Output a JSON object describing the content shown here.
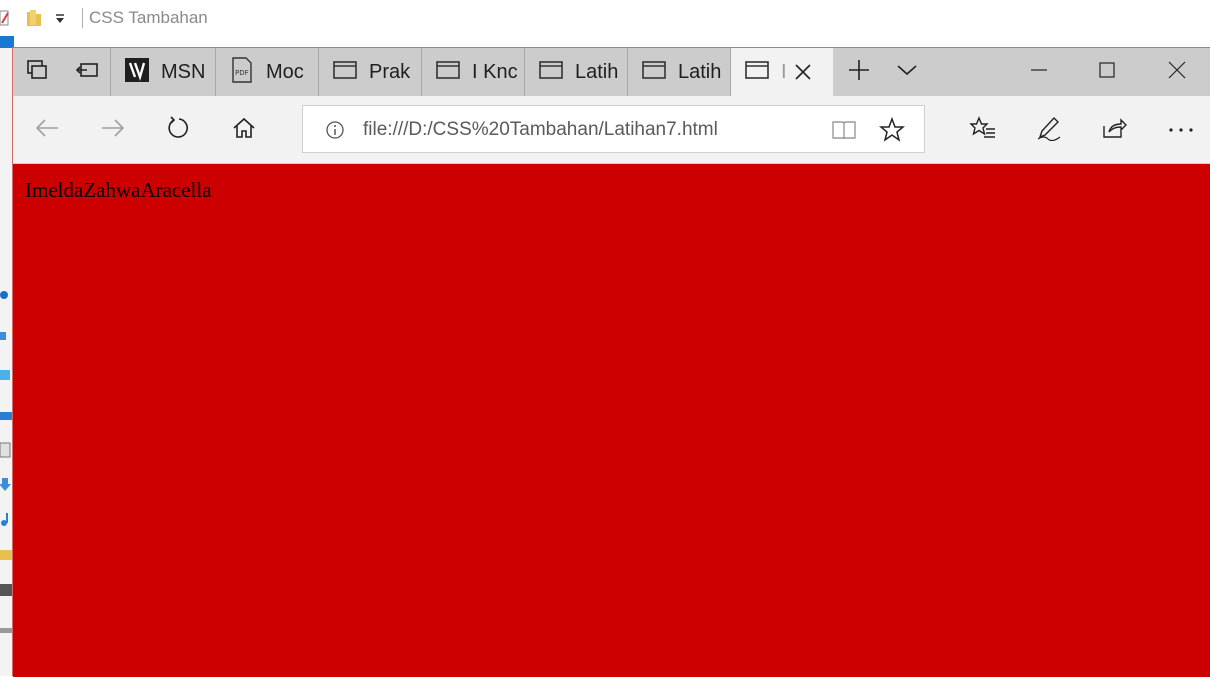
{
  "explorer": {
    "title": "CSS Tambahan"
  },
  "browser": {
    "tabs": [
      {
        "label": "MSN",
        "icon": "msn-icon"
      },
      {
        "label": "Moc",
        "icon": "pdf-icon"
      },
      {
        "label": "Prak",
        "icon": "page-icon"
      },
      {
        "label": "I Knc",
        "icon": "page-icon"
      },
      {
        "label": "Latih",
        "icon": "page-icon"
      },
      {
        "label": "Latih",
        "icon": "page-icon"
      },
      {
        "label": "I",
        "icon": "page-icon"
      }
    ],
    "url": "file:///D:/CSS%20Tambahan/Latihan7.html"
  },
  "page": {
    "text": "ImeldaZahwaAracella",
    "background": "#cc0000"
  }
}
